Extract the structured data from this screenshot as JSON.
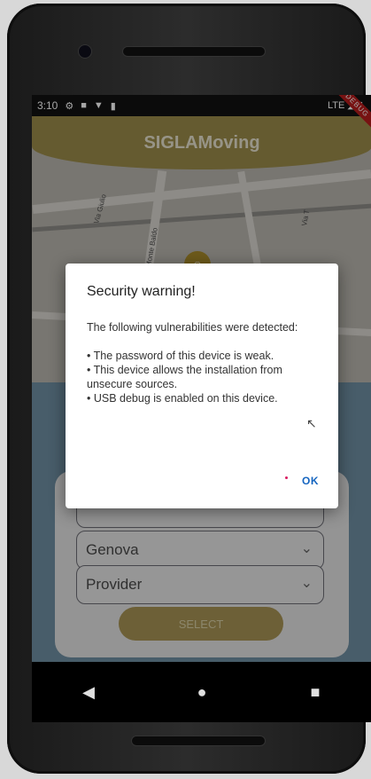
{
  "status_bar": {
    "time": "3:10",
    "icons": [
      "gear-icon",
      "square-icon",
      "wifi-off-icon",
      "sd-card-icon"
    ],
    "network": "LTE",
    "debug_ribbon": "DEBUG"
  },
  "app": {
    "title": "SIGLAMoving",
    "accent_color": "#9c8c4a"
  },
  "map": {
    "labels": [
      "Via Giulio",
      "Via Monte Baldo",
      "Via T"
    ]
  },
  "form": {
    "city_value": "Genova",
    "provider_placeholder": "Provider",
    "select_label": "SELECT"
  },
  "dialog": {
    "title": "Security warning!",
    "intro": "The following vulnerabilities were detected:",
    "items": [
      "• The password of this device is weak.",
      "• This device allows the installation from unsecure sources.",
      "• USB debug is enabled on this device."
    ],
    "ok_label": "OK"
  },
  "nav": {
    "back": "◀",
    "home": "●",
    "recents": "■"
  }
}
